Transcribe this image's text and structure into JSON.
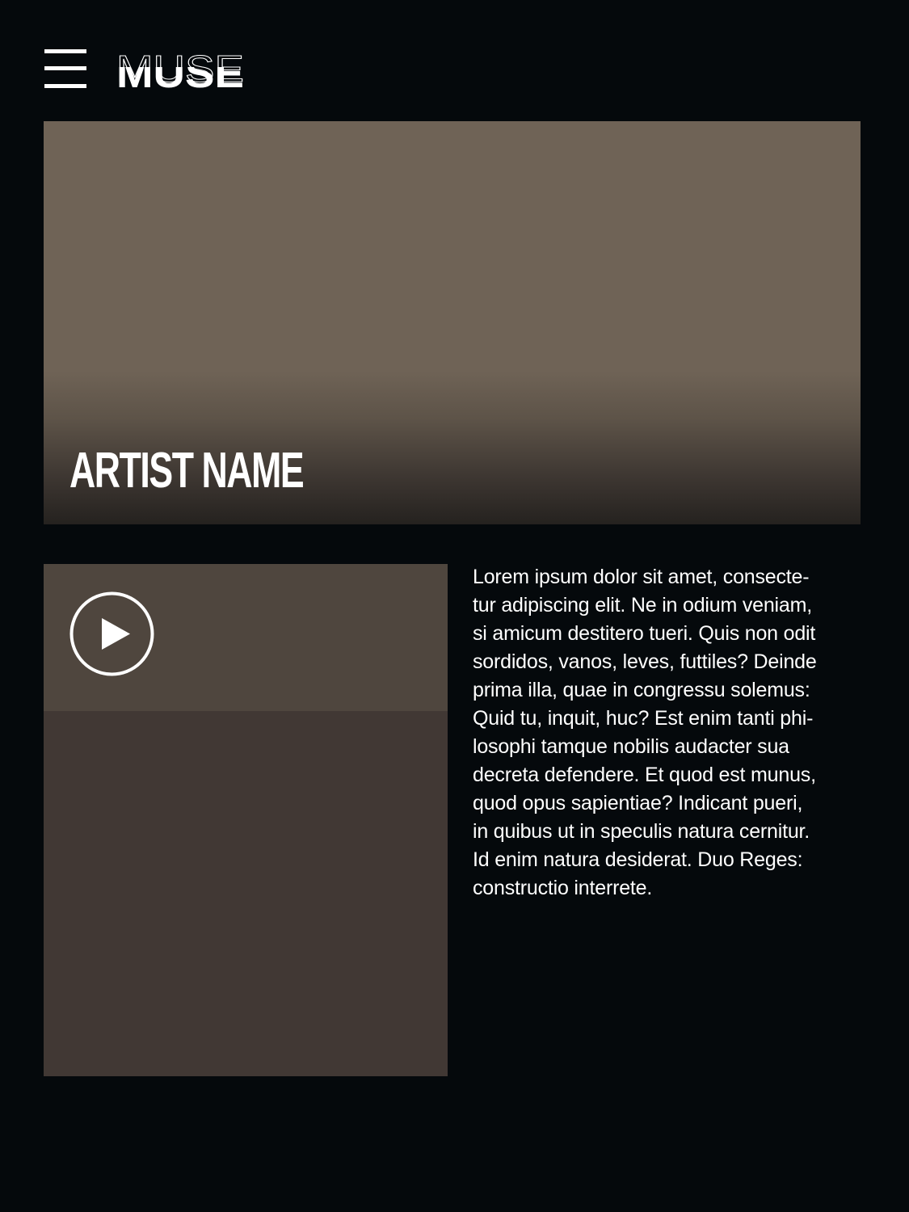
{
  "header": {
    "menu_icon": "hamburger-menu-icon",
    "logo_text": "MUSE"
  },
  "hero": {
    "artist_name": "ARTIST NAME"
  },
  "video": {
    "play_icon": "play-circle-icon"
  },
  "description": {
    "lines": [
      "Lorem ipsum dolor sit amet, consecte-",
      "tur adipiscing elit. Ne in odium veniam,",
      "si amicum destitero tueri. Quis non odit",
      "sordidos, vanos, leves, futtiles? Deinde",
      "prima illa, quae in congressu solemus:",
      "Quid tu, inquit, huc? Est enim tanti phi-",
      "losophi tamque nobilis audacter sua",
      "decreta defendere. Et quod est munus,",
      "quod opus sapientiae? Indicant pueri,",
      "in quibus ut in speculis natura cernitur.",
      "Id enim natura desiderat. Duo Reges:",
      "constructio interrete."
    ]
  },
  "colors": {
    "page_background": "#05090c",
    "hero_background": "#6f6356",
    "video_top": "#4f463e",
    "video_bottom": "#413834",
    "text": "#ffffff"
  }
}
